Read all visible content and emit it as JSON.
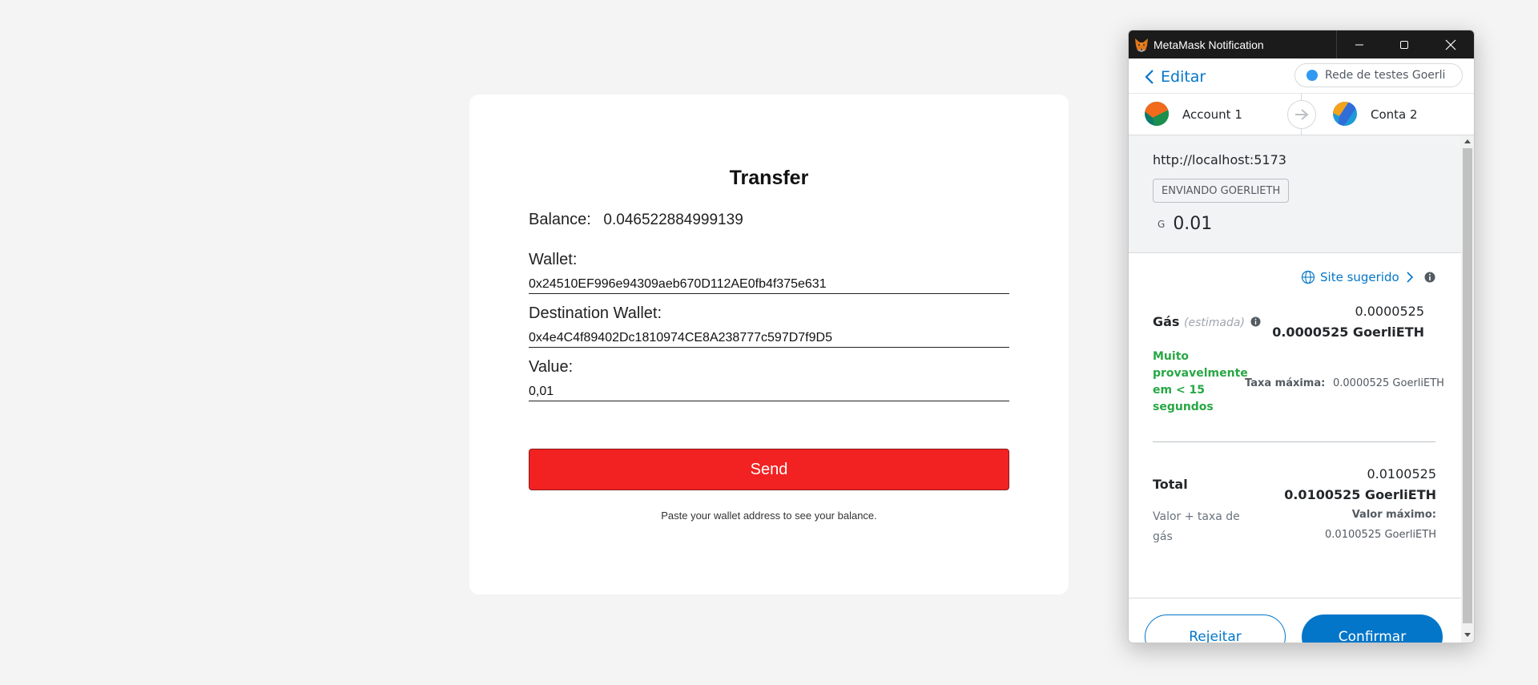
{
  "transfer": {
    "title": "Transfer",
    "balance_label": "Balance:",
    "balance_value": "0.046522884999139",
    "wallet_label": "Wallet:",
    "wallet_value": "0x24510EF996e94309aeb670D112AE0fb4f375e631",
    "destination_label": "Destination Wallet:",
    "destination_value": "0x4e4C4f89402Dc1810974CE8A238777c597D7f9D5",
    "value_label": "Value:",
    "value_value": "0,01",
    "send_label": "Send",
    "hint": "Paste your wallet address to see your balance.",
    "send_color": "#f22222"
  },
  "metamask": {
    "window_title": "MetaMask Notification",
    "back_label": "Editar",
    "network": "Rede de testes Goerli",
    "from_account": "Account 1",
    "to_account": "Conta 2",
    "origin": "http://localhost:5173",
    "tx_type": "ENVIANDO GOERLIETH",
    "amount_symbol": "G",
    "amount": "0.01",
    "site_suggested": "Site sugerido",
    "gas_label": "Gás",
    "gas_estimated": "(estimada)",
    "gas_fiat": "0.0000525",
    "gas_native": "0.0000525 GoerliETH",
    "likely_text": "Muito provavelmente em < 15 segundos",
    "max_fee_label": "Taxa máxima:",
    "max_fee_value": "0.0000525 GoerliETH",
    "total_label": "Total",
    "total_fiat": "0.0100525",
    "total_native": "0.0100525 GoerliETH",
    "total_sub": "Valor + taxa de gás",
    "max_amount_label": "Valor máximo:",
    "max_amount_value": "0.0100525 GoerliETH",
    "reject_label": "Rejeitar",
    "confirm_label": "Confirmar",
    "accent_color": "#0376c9",
    "network_dot_color": "#3099f2"
  }
}
